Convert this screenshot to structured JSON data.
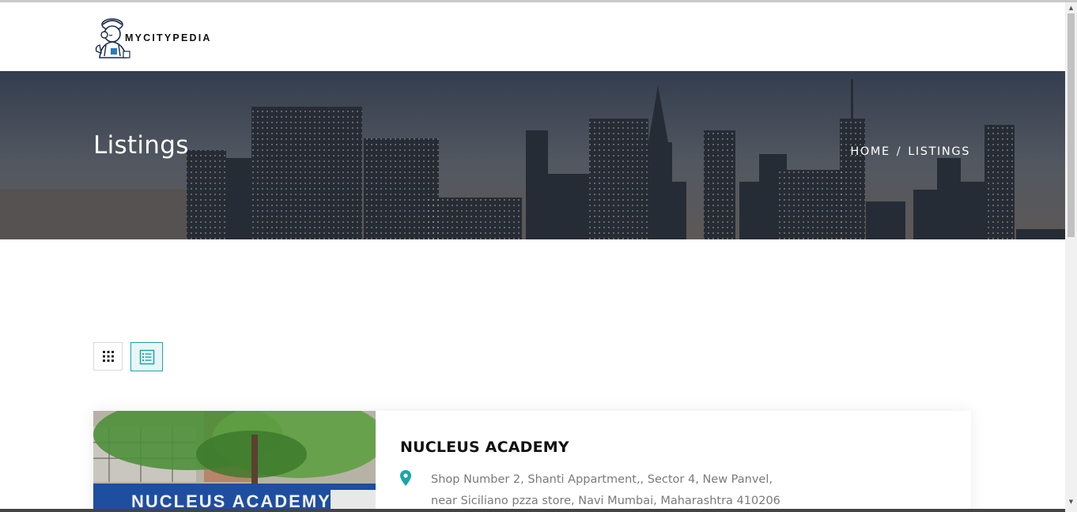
{
  "header": {
    "logo_text": "MYCITYPEDIA"
  },
  "hero": {
    "title": "Listings",
    "breadcrumb": {
      "home": "HOME",
      "separator": "/",
      "current": "LISTINGS"
    }
  },
  "view_toggle": {
    "grid_icon": "grid-icon",
    "list_icon": "list-icon",
    "active": "list"
  },
  "listing": {
    "title": "NUCLEUS ACADEMY",
    "address_line1": "Shop Number 2, Shanti Appartment,, Sector 4, New Panvel,",
    "address_line2": "near Siciliano pzza store, Navi Mumbai, Maharashtra 410206",
    "image_sign_text": "NUCLEUS ACADEMY",
    "pin_icon": "map-pin-icon"
  },
  "colors": {
    "accent": "#1aa6a6",
    "text_dark": "#111111",
    "text_muted": "#7a7a7a"
  }
}
